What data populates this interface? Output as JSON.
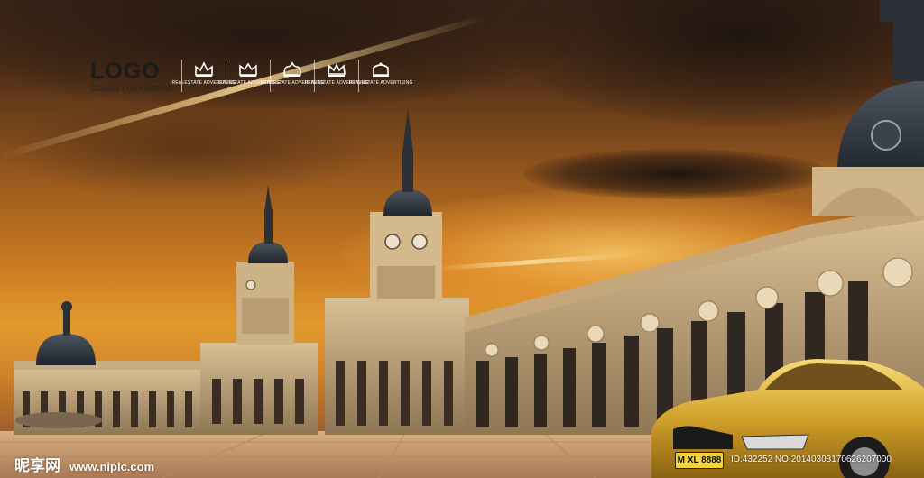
{
  "logo": {
    "title": "LOGO",
    "subtitle": "GONGS I QUANCENG"
  },
  "crowns": [
    {
      "icon": "crown-icon",
      "caption": "REALESTATE ADVERTISING"
    },
    {
      "icon": "crown-icon",
      "caption": "REALESTATE ADVERTISING"
    },
    {
      "icon": "crown-icon",
      "caption": "REALESTATE ADVERTISING"
    },
    {
      "icon": "crown-icon",
      "caption": "REALESTATE ADVERTISING"
    },
    {
      "icon": "crown-icon",
      "caption": "REALESTATE ADVERTISING"
    }
  ],
  "car": {
    "plate": "M XL 8888",
    "color": "#d4a52c"
  },
  "watermark": {
    "brand": "昵享网",
    "url": "www.nipic.com",
    "id_line": "ID:432252 NO:20140303170626207000"
  },
  "colors": {
    "sky_top": "#3a2418",
    "sky_glow": "#e39a2f",
    "building": "#c9b08a",
    "ground": "#c49a72"
  }
}
